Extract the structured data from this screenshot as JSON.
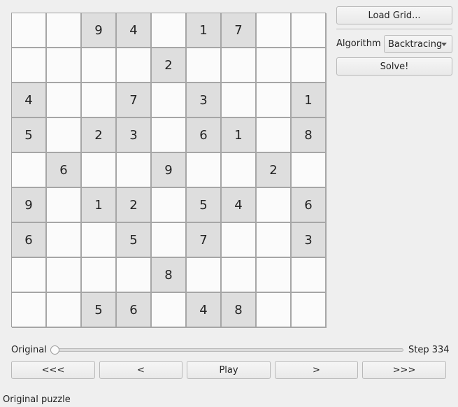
{
  "grid": [
    [
      "",
      "",
      "9",
      "4",
      "",
      "1",
      "7",
      "",
      ""
    ],
    [
      "",
      "",
      "",
      "",
      "2",
      "",
      "",
      "",
      ""
    ],
    [
      "4",
      "",
      "",
      "7",
      "",
      "3",
      "",
      "",
      "1"
    ],
    [
      "5",
      "",
      "2",
      "3",
      "",
      "6",
      "1",
      "",
      "8"
    ],
    [
      "",
      "6",
      "",
      "",
      "9",
      "",
      "",
      "2",
      ""
    ],
    [
      "9",
      "",
      "1",
      "2",
      "",
      "5",
      "4",
      "",
      "6"
    ],
    [
      "6",
      "",
      "",
      "5",
      "",
      "7",
      "",
      "",
      "3"
    ],
    [
      "",
      "",
      "",
      "",
      "8",
      "",
      "",
      "",
      ""
    ],
    [
      "",
      "",
      "5",
      "6",
      "",
      "4",
      "8",
      "",
      ""
    ]
  ],
  "given_mask": [
    [
      0,
      0,
      1,
      1,
      0,
      1,
      1,
      0,
      0
    ],
    [
      0,
      0,
      0,
      0,
      1,
      0,
      0,
      0,
      0
    ],
    [
      1,
      0,
      0,
      1,
      0,
      1,
      0,
      0,
      1
    ],
    [
      1,
      0,
      1,
      1,
      0,
      1,
      1,
      0,
      1
    ],
    [
      0,
      1,
      0,
      0,
      1,
      0,
      0,
      1,
      0
    ],
    [
      1,
      0,
      1,
      1,
      0,
      1,
      1,
      0,
      1
    ],
    [
      1,
      0,
      0,
      1,
      0,
      1,
      0,
      0,
      1
    ],
    [
      0,
      0,
      0,
      0,
      1,
      0,
      0,
      0,
      0
    ],
    [
      0,
      0,
      1,
      1,
      0,
      1,
      1,
      0,
      0
    ]
  ],
  "panel": {
    "load_label": "Load Grid...",
    "algorithm_label": "Algorithm",
    "algorithm_value": "Backtracing",
    "solve_label": "Solve!"
  },
  "playback": {
    "slider_left_label": "Original",
    "step_label": "Step 334",
    "slider_position": 0,
    "first_label": "<<<",
    "prev_label": "<",
    "play_label": "Play",
    "next_label": ">",
    "last_label": ">>>"
  },
  "status": {
    "text": "Original puzzle"
  },
  "colors": {
    "given_cell": "#dedede",
    "empty_cell": "#fbfbfb",
    "background": "#efefef"
  }
}
